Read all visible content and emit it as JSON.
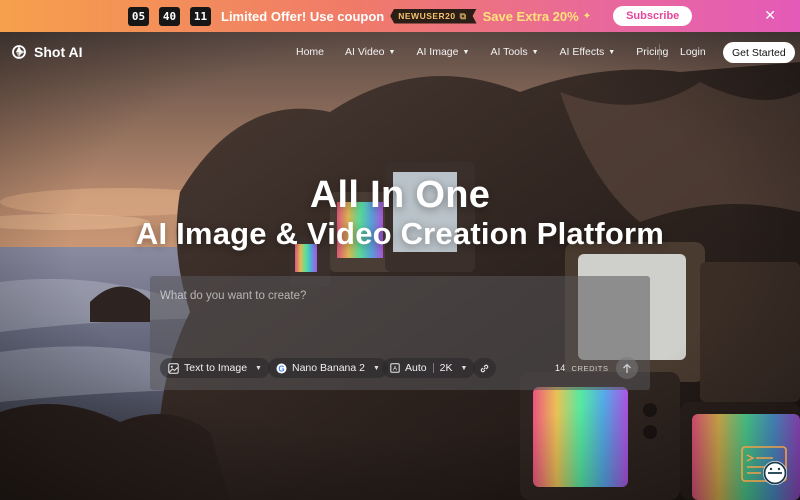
{
  "banner": {
    "timer": [
      "05",
      "40",
      "11"
    ],
    "offer_text": "Limited Offer!  Use coupon",
    "coupon_code": "NEWUSER20",
    "save_text": "Save Extra 20%",
    "subscribe_label": "Subscribe",
    "close_icon": "close-icon"
  },
  "nav": {
    "brand": "Shot AI",
    "items": [
      {
        "label": "Home",
        "dropdown": false
      },
      {
        "label": "AI Video",
        "dropdown": true
      },
      {
        "label": "AI Image",
        "dropdown": true
      },
      {
        "label": "AI Tools",
        "dropdown": true
      },
      {
        "label": "AI Effects",
        "dropdown": true
      },
      {
        "label": "Pricing",
        "dropdown": false
      }
    ],
    "login_label": "Login",
    "cta_label": "Get Started"
  },
  "hero": {
    "title": "All In One",
    "subtitle": "AI Image & Video Creation Platform"
  },
  "prompt": {
    "placeholder": "What do you want to create?",
    "mode_label": "Text to Image",
    "model_label": "Nano Banana 2",
    "aspect_label": "Auto",
    "resolution_label": "2K",
    "credits_value": "14",
    "credits_label": "CREDITS"
  },
  "colors": {
    "banner_start": "#f6a04b",
    "banner_end": "#e45ab8",
    "subscribe_text": "#e4469a",
    "save_text": "#ffe27a"
  }
}
